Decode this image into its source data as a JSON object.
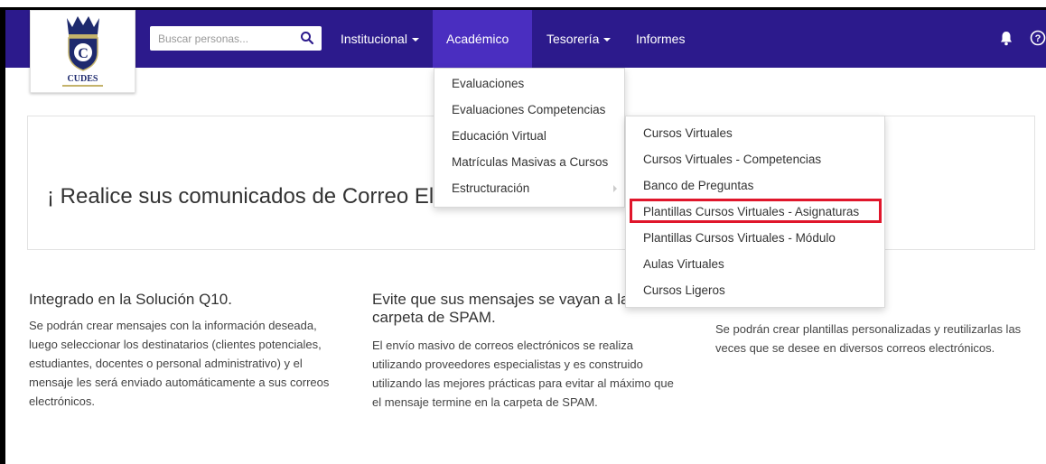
{
  "logo": {
    "text": "CUDES"
  },
  "search": {
    "placeholder": "Buscar personas..."
  },
  "nav": {
    "items": [
      {
        "label": "Institucional",
        "has_caret": true
      },
      {
        "label": "Académico",
        "has_caret": true,
        "active": true
      },
      {
        "label": "Tesorería",
        "has_caret": true
      },
      {
        "label": "Informes",
        "has_caret": false
      }
    ]
  },
  "academico_menu": {
    "items": [
      "Evaluaciones",
      "Evaluaciones Competencias",
      "Educación Virtual",
      "Matrículas Masivas a Cursos",
      "Estructuración"
    ]
  },
  "educacion_virtual_menu": {
    "items": [
      "Cursos Virtuales",
      "Cursos Virtuales - Competencias",
      "Banco de Preguntas",
      "Plantillas Cursos Virtuales - Asignaturas",
      "Plantillas Cursos Virtuales - Módulo",
      "Aulas Virtuales",
      "Cursos Ligeros"
    ],
    "highlighted_index": 3
  },
  "main": {
    "title": "¡ Realice sus comunicados de Correo El",
    "columns": [
      {
        "heading": "Integrado en la Solución Q10.",
        "body": "Se podrán crear mensajes con la información deseada, luego seleccionar los destinatarios (clientes potenciales, estudiantes, docentes o personal administrativo) y el mensaje les será enviado automáticamente a sus correos electrónicos."
      },
      {
        "heading": "Evite que sus mensajes se vayan a la carpeta de SPAM.",
        "body": "El envío masivo de correos electrónicos se realiza utilizando proveedores especialistas y es construido utilizando las mejores prácticas para evitar al máximo que el mensaje termine en la carpeta de SPAM."
      },
      {
        "heading": "",
        "body": "Se podrán crear plantillas personalizadas y reutilizarlas las veces que se desee en diversos correos electrónicos."
      }
    ]
  },
  "colors": {
    "navbar": "#2c1a8c",
    "nav_active": "#4a2ec0",
    "highlight": "#e0162b"
  }
}
